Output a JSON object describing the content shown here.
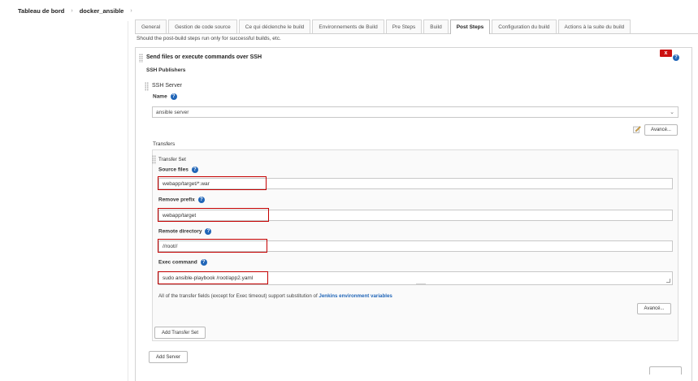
{
  "breadcrumb": {
    "home": "Tableau de bord",
    "job": "docker_ansible"
  },
  "tabs": [
    {
      "label": "General"
    },
    {
      "label": "Gestion de code source"
    },
    {
      "label": "Ce qui déclenche le build"
    },
    {
      "label": "Environnements de Build"
    },
    {
      "label": "Pre Steps"
    },
    {
      "label": "Build"
    },
    {
      "label": "Post Steps"
    },
    {
      "label": "Configuration du build"
    },
    {
      "label": "Actions à la suite du build"
    }
  ],
  "active_tab": "Post Steps",
  "post_steps_note": "Should the post-build steps run only for successful builds, etc.",
  "step": {
    "title": "Send files or execute commands over SSH",
    "close_label": "x",
    "publishers_label": "SSH Publishers",
    "server_section_label": "SSH Server",
    "name_label": "Name",
    "name_value": "ansible server",
    "advanced_label": "Avancé...",
    "transfers_label": "Transfers",
    "transfer_set_label": "Transfer Set",
    "source_files_label": "Source files",
    "source_files_value": "webapp/target/*.war",
    "remove_prefix_label": "Remove prefix",
    "remove_prefix_value": "webapp/target",
    "remote_directory_label": "Remote directory",
    "remote_directory_value": "//root//",
    "exec_command_label": "Exec command",
    "exec_command_value": "sudo ansible-playbook /root/app2.yaml",
    "substitution_note": "All of the transfer fields (except for Exec timeout) support substitution of",
    "substitution_link": "Jenkins environment variables",
    "transfer_advanced_label": "Avancé...",
    "add_transfer_set_label": "Add Transfer Set",
    "add_server_label": "Add Server"
  },
  "help_glyph": "?",
  "colors": {
    "highlight": "#c40000",
    "help": "#2166b8",
    "close": "#cc1111"
  }
}
